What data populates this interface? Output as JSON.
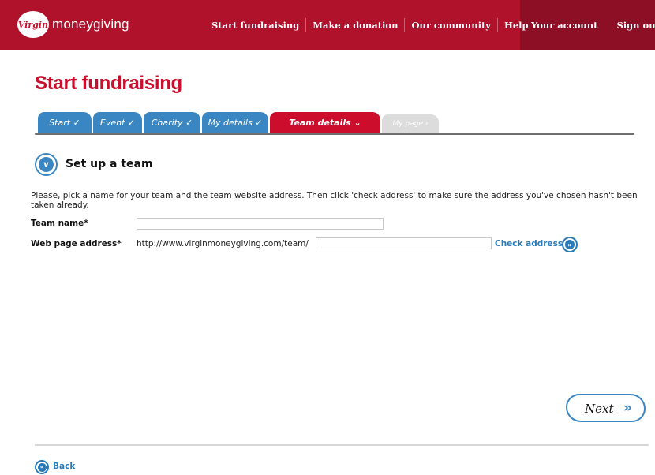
{
  "header": {
    "logo_badge": "Virgin",
    "logo_text": "moneygiving",
    "nav_left": [
      "Start fundraising",
      "Make a donation",
      "Our community",
      "Help"
    ],
    "nav_right": [
      "Your account",
      "Sign out"
    ],
    "brand_color": "#b0112b"
  },
  "page": {
    "title": "Start fundraising"
  },
  "tabs": [
    {
      "label": "Start ✓",
      "state": "done"
    },
    {
      "label": "Event ✓",
      "state": "done"
    },
    {
      "label": "Charity ✓",
      "state": "done"
    },
    {
      "label": "My details ✓",
      "state": "done"
    },
    {
      "label": "Team details ⌄",
      "state": "active"
    },
    {
      "label": "My page ›",
      "state": "future"
    }
  ],
  "section": {
    "icon": "double-chevron-down-icon",
    "title": "Set up a team",
    "instructions": "Please, pick a name for your team and the team website address. Then click 'check address' to make sure the address you've chosen hasn't been taken already."
  },
  "form": {
    "team_name_label": "Team name*",
    "team_name_value": "",
    "web_address_label": "Web page address*",
    "url_prefix": "http://www.virginmoneygiving.com/team/",
    "web_address_value": "",
    "check_label": "Check address"
  },
  "actions": {
    "next_label": "Next",
    "next_arrows": "»",
    "back_label": "Back"
  }
}
